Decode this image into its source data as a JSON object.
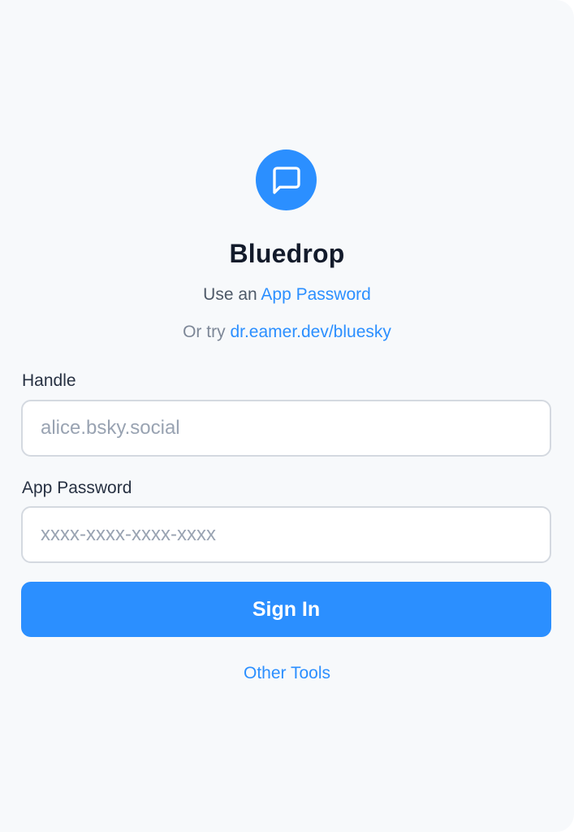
{
  "app": {
    "title": "Bluedrop",
    "logo_icon": "message-square-icon",
    "accent_color": "#2b8fff"
  },
  "intro": {
    "line1_prefix": "Use an",
    "line1_link": "App Password",
    "line2_prefix": "Or try",
    "line2_link": "dr.eamer.dev/bluesky"
  },
  "form": {
    "handle_label": "Handle",
    "handle_placeholder": "alice.bsky.social",
    "handle_value": "",
    "password_label": "App Password",
    "password_placeholder": "xxxx-xxxx-xxxx-xxxx",
    "password_value": "",
    "submit_label": "Sign In"
  },
  "footer": {
    "other_tools_label": "Other Tools"
  }
}
